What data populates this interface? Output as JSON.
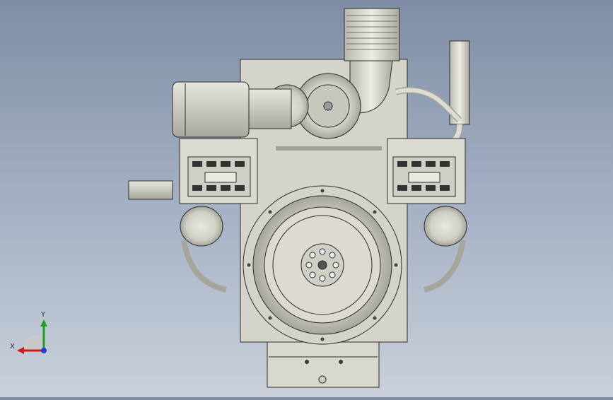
{
  "viewport": {
    "background_top": "#7f8ea6",
    "background_bottom": "#c9d0da",
    "model_fill": "#d9d9cf",
    "model_stroke": "#2b2b2b"
  },
  "triad": {
    "x_label": "X",
    "y_label": "Y",
    "x_color": "#d01818",
    "y_color": "#1ea01e",
    "z_color": "#1f3fd6"
  }
}
